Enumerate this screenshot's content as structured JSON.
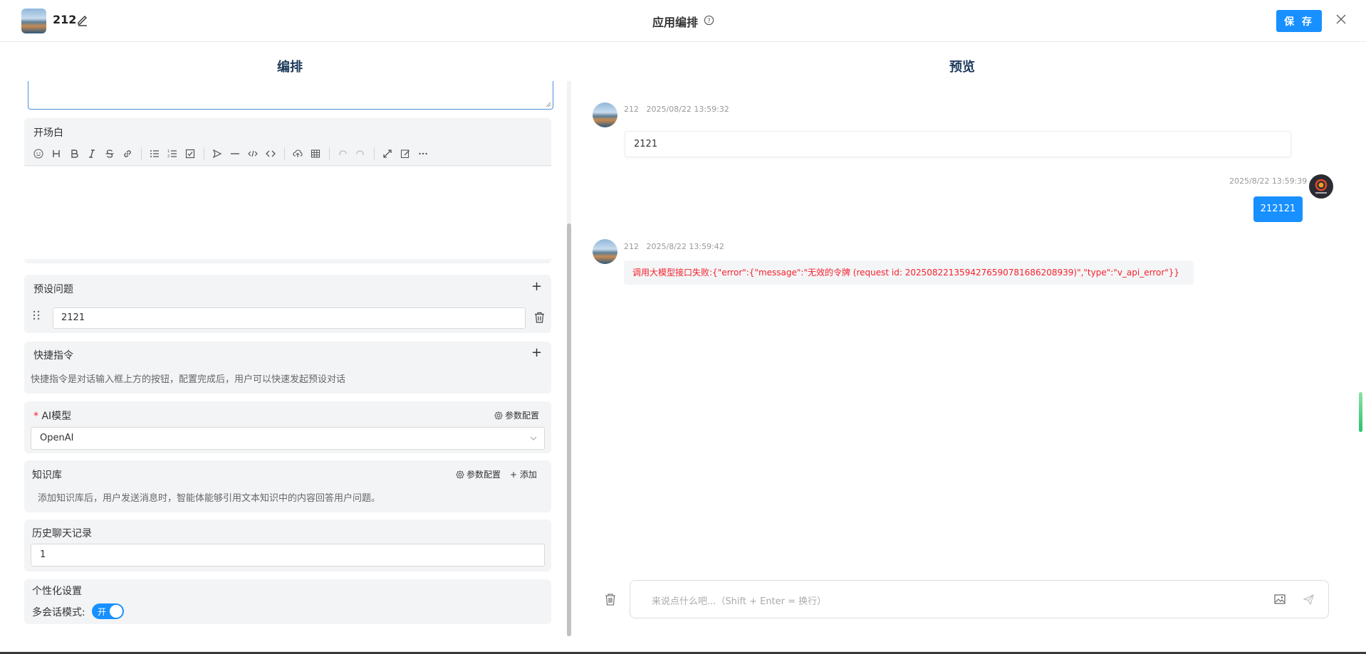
{
  "header": {
    "app_name": "212",
    "page_title": "应用编排",
    "save_label": "保 存"
  },
  "columns": {
    "left_title": "编排",
    "right_title": "预览"
  },
  "opening": {
    "title": "开场白",
    "toolbar_icons": [
      "emoji-icon",
      "heading-icon",
      "bold-icon",
      "italic-icon",
      "strike-icon",
      "link-icon",
      "bullet-list-icon",
      "ordered-list-icon",
      "checklist-icon",
      "quote-icon",
      "divider-icon",
      "inline-code-icon",
      "code-block-icon",
      "upload-icon",
      "table-icon",
      "undo-icon",
      "redo-icon",
      "fullscreen-icon",
      "edit-mode-icon",
      "more-icon"
    ]
  },
  "preset": {
    "title": "预设问题",
    "value": "2121"
  },
  "commands": {
    "title": "快捷指令",
    "desc": "快捷指令是对话输入框上方的按钮，配置完成后，用户可以快速发起预设对话"
  },
  "model": {
    "required_mark": "*",
    "title": "AI模型",
    "param_label": "参数配置",
    "selected": "OpenAI"
  },
  "knowledge": {
    "title": "知识库",
    "param_label": "参数配置",
    "add_label": "+ 添加",
    "desc": "添加知识库后，用户发送消息时，智能体能够引用文本知识中的内容回答用户问题。"
  },
  "history": {
    "title": "历史聊天记录",
    "value": "1"
  },
  "personal": {
    "title": "个性化设置",
    "mode_label": "多会话模式:",
    "toggle_label": "开"
  },
  "chat": {
    "messages": [
      {
        "sender": "212",
        "time": "2025/08/22 13:59:32",
        "text": "2121"
      },
      {
        "sender": "",
        "time": "2025/8/22 13:59:39",
        "text": "212121"
      },
      {
        "sender": "212",
        "time": "2025/8/22 13:59:42",
        "text": "调用大模型接口失败:{\"error\":{\"message\":\"无效的令牌 (request id: 20250822135942765907816862089​39)\",\"type\":\"v_api_error\"}}"
      }
    ],
    "input_placeholder": "来说点什么吧...（Shift + Enter = 换行）"
  },
  "colors": {
    "accent": "#1890ff",
    "error": "#f5222d",
    "card_bg": "#f3f4f6"
  }
}
